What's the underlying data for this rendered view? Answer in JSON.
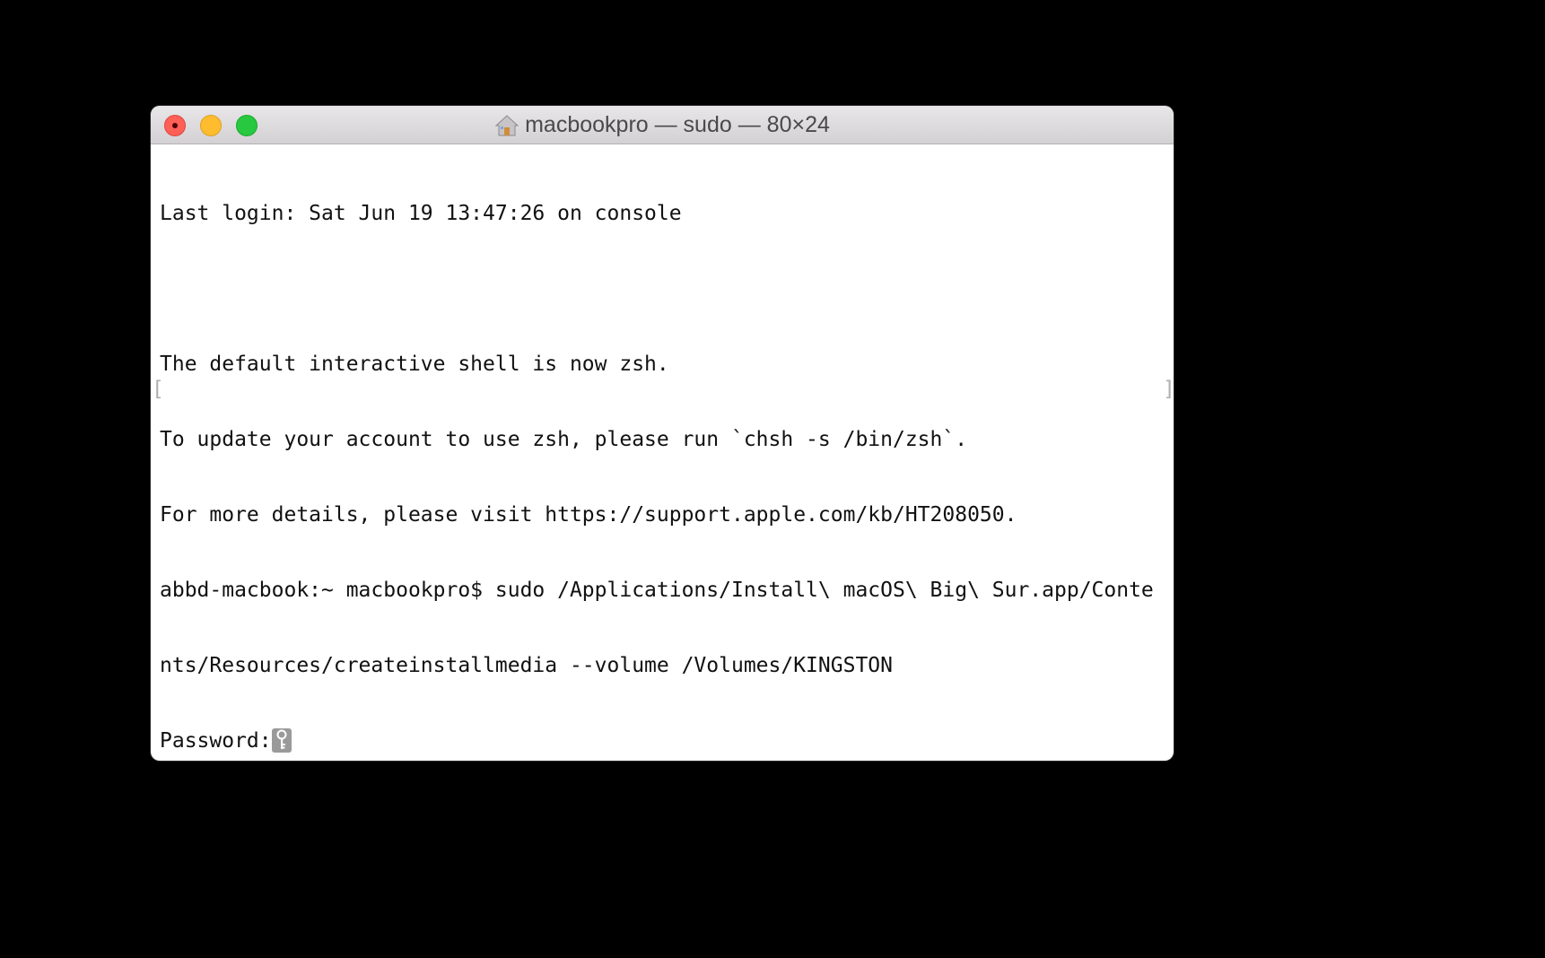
{
  "window": {
    "title": "macbookpro — sudo — 80×24",
    "title_icon": "home-folder-icon",
    "controls": {
      "close": "close-button",
      "minimize": "minimize-button",
      "maximize": "maximize-button"
    }
  },
  "terminal": {
    "lines": [
      "Last login: Sat Jun 19 13:47:26 on console",
      "",
      "The default interactive shell is now zsh.",
      "To update your account to use zsh, please run `chsh -s /bin/zsh`.",
      "For more details, please visit https://support.apple.com/kb/HT208050.",
      "abbd-macbook:~ macbookpro$ sudo /Applications/Install\\ macOS\\ Big\\ Sur.app/Conte",
      "nts/Resources/createinstallmedia --volume /Volumes/KINGSTON"
    ],
    "prompt_label": "Password:",
    "cursor_icon": "key-icon",
    "left_bracket": "[",
    "right_bracket": "]"
  },
  "colors": {
    "background": "#000000",
    "window": "#ffffff",
    "close": "#fe5f57",
    "minimize": "#febc2e",
    "maximize": "#28c840"
  }
}
